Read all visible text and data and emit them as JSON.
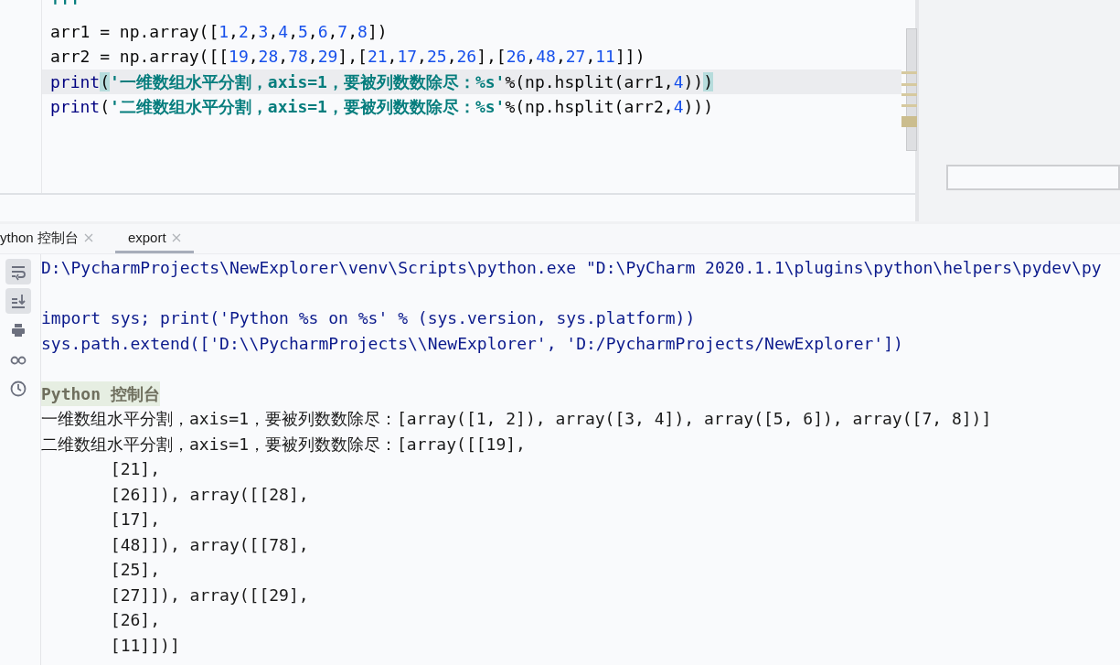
{
  "editor": {
    "lines": [
      {
        "current": false,
        "segments": [
          {
            "text": "'''",
            "kind": "string"
          }
        ]
      },
      {
        "current": false,
        "segments": [
          {
            "text": "arr1 = np.array([",
            "kind": "plain"
          },
          {
            "text": "1",
            "kind": "number"
          },
          {
            "text": ",",
            "kind": "plain"
          },
          {
            "text": "2",
            "kind": "number"
          },
          {
            "text": ",",
            "kind": "plain"
          },
          {
            "text": "3",
            "kind": "number"
          },
          {
            "text": ",",
            "kind": "plain"
          },
          {
            "text": "4",
            "kind": "number"
          },
          {
            "text": ",",
            "kind": "plain"
          },
          {
            "text": "5",
            "kind": "number"
          },
          {
            "text": ",",
            "kind": "plain"
          },
          {
            "text": "6",
            "kind": "number"
          },
          {
            "text": ",",
            "kind": "plain"
          },
          {
            "text": "7",
            "kind": "number"
          },
          {
            "text": ",",
            "kind": "plain"
          },
          {
            "text": "8",
            "kind": "number"
          },
          {
            "text": "])",
            "kind": "plain"
          }
        ]
      },
      {
        "current": false,
        "segments": [
          {
            "text": "arr2 = np.array([[",
            "kind": "plain"
          },
          {
            "text": "19",
            "kind": "number"
          },
          {
            "text": ",",
            "kind": "plain"
          },
          {
            "text": "28",
            "kind": "number"
          },
          {
            "text": ",",
            "kind": "plain"
          },
          {
            "text": "78",
            "kind": "number"
          },
          {
            "text": ",",
            "kind": "plain"
          },
          {
            "text": "29",
            "kind": "number"
          },
          {
            "text": "],[",
            "kind": "plain"
          },
          {
            "text": "21",
            "kind": "number"
          },
          {
            "text": ",",
            "kind": "plain"
          },
          {
            "text": "17",
            "kind": "number"
          },
          {
            "text": ",",
            "kind": "plain"
          },
          {
            "text": "25",
            "kind": "number"
          },
          {
            "text": ",",
            "kind": "plain"
          },
          {
            "text": "26",
            "kind": "number"
          },
          {
            "text": "],[",
            "kind": "plain"
          },
          {
            "text": "26",
            "kind": "number"
          },
          {
            "text": ",",
            "kind": "plain"
          },
          {
            "text": "48",
            "kind": "number"
          },
          {
            "text": ",",
            "kind": "plain"
          },
          {
            "text": "27",
            "kind": "number"
          },
          {
            "text": ",",
            "kind": "plain"
          },
          {
            "text": "11",
            "kind": "number"
          },
          {
            "text": "]])",
            "kind": "plain"
          }
        ]
      },
      {
        "current": true,
        "segments": [
          {
            "text": "print",
            "kind": "builtin"
          },
          {
            "text": "(",
            "kind": "match"
          },
          {
            "text": "'一维数组水平分割，axis=1，要被列数数除尽：%s'",
            "kind": "string"
          },
          {
            "text": "%(np.hsplit(arr1,",
            "kind": "plain"
          },
          {
            "text": "4",
            "kind": "number"
          },
          {
            "text": "))",
            "kind": "plain"
          },
          {
            "text": ")",
            "kind": "match"
          }
        ]
      },
      {
        "current": false,
        "segments": [
          {
            "text": "print",
            "kind": "builtin"
          },
          {
            "text": "(",
            "kind": "plain"
          },
          {
            "text": "'二维数组水平分割，axis=1，要被列数数除尽：%s'",
            "kind": "string"
          },
          {
            "text": "%(np.hsplit(arr2,",
            "kind": "plain"
          },
          {
            "text": "4",
            "kind": "number"
          },
          {
            "text": ")))",
            "kind": "plain"
          }
        ]
      }
    ]
  },
  "console": {
    "tabs": [
      {
        "label": "ython 控制台",
        "selected": false
      },
      {
        "label": "export",
        "selected": true
      }
    ],
    "tools": [
      {
        "kind": "wrap",
        "selected": true
      },
      {
        "kind": "scroll-end",
        "selected": true
      },
      {
        "kind": "print",
        "selected": false
      },
      {
        "kind": "glasses",
        "selected": false
      },
      {
        "kind": "clock",
        "selected": false
      }
    ],
    "lines": [
      {
        "kind": "command",
        "text": "D:\\PycharmProjects\\NewExplorer\\venv\\Scripts\\python.exe \"D:\\PyCharm 2020.1.1\\plugins\\python\\helpers\\pydev\\py"
      },
      {
        "kind": "blank"
      },
      {
        "kind": "command",
        "text": "import sys; print('Python %s on %s' % (sys.version, sys.platform))"
      },
      {
        "kind": "command",
        "text": "sys.path.extend(['D:\\\\PycharmProjects\\\\NewExplorer', 'D:/PycharmProjects/NewExplorer'])"
      },
      {
        "kind": "blank"
      },
      {
        "kind": "banner",
        "text": "Python 控制台"
      },
      {
        "kind": "output",
        "text": "一维数组水平分割，axis=1，要被列数数除尽：[array([1, 2]), array([3, 4]), array([5, 6]), array([7, 8])]"
      },
      {
        "kind": "output",
        "text": "二维数组水平分割，axis=1，要被列数数除尽：[array([[19],"
      },
      {
        "kind": "output",
        "text": "       [21],"
      },
      {
        "kind": "output",
        "text": "       [26]]), array([[28],"
      },
      {
        "kind": "output",
        "text": "       [17],"
      },
      {
        "kind": "output",
        "text": "       [48]]), array([[78],"
      },
      {
        "kind": "output",
        "text": "       [25],"
      },
      {
        "kind": "output",
        "text": "       [27]]), array([[29],"
      },
      {
        "kind": "output",
        "text": "       [26],"
      },
      {
        "kind": "output",
        "text": "       [11]])]"
      }
    ]
  }
}
